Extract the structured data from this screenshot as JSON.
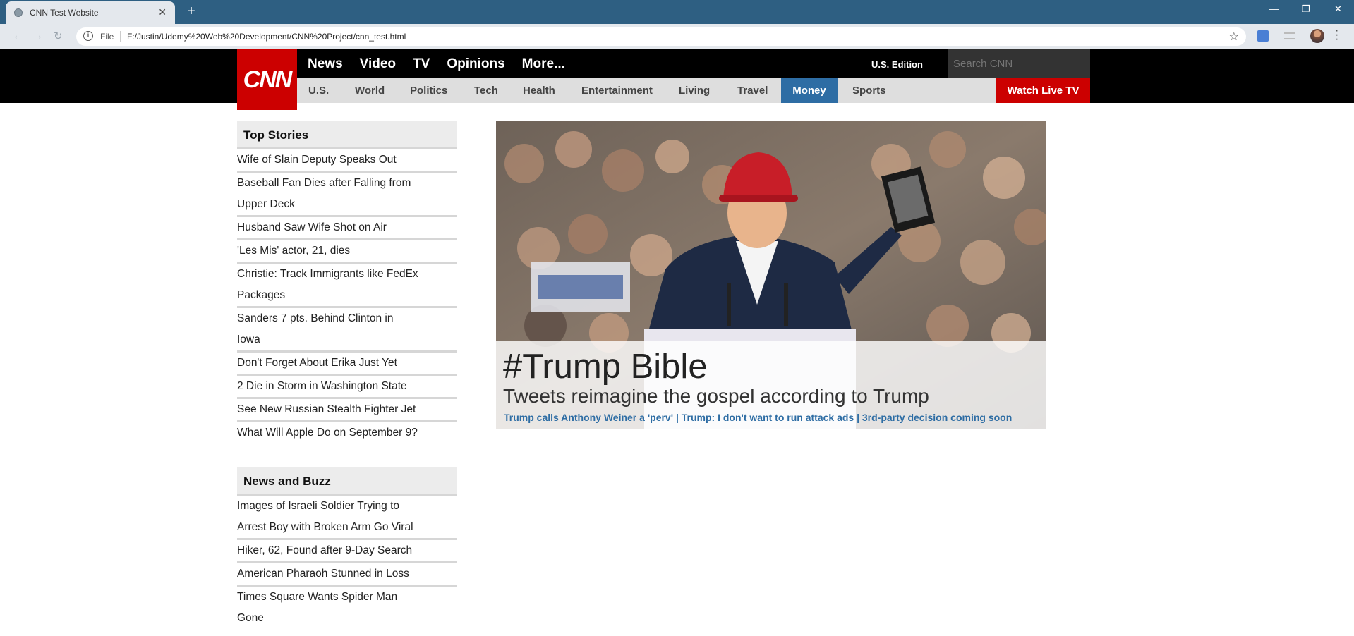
{
  "browser": {
    "tab_title": "CNN Test Website",
    "tab_close": "✕",
    "new_tab": "+",
    "scheme": "File",
    "url": "F:/Justin/Udemy%20Web%20Development/CNN%20Project/cnn_test.html",
    "window_controls": [
      "—",
      "❐",
      "✕"
    ]
  },
  "header": {
    "logo": "CNN",
    "top_nav": [
      "News",
      "Video",
      "TV",
      "Opinions",
      "More..."
    ],
    "edition": "U.S. Edition",
    "search_placeholder": "Search CNN",
    "sub_nav": [
      "U.S.",
      "World",
      "Politics",
      "Tech",
      "Health",
      "Entertainment",
      "Living",
      "Travel",
      "Money",
      "Sports"
    ],
    "active_sub_nav": "Money",
    "watch_live": "Watch Live TV",
    "colors": {
      "brand_red": "#cc0000",
      "active_blue": "#2e6da4"
    }
  },
  "sidebar": {
    "top_stories_title": "Top Stories",
    "top_stories": [
      "Wife of Slain Deputy Speaks Out",
      "Baseball Fan Dies after Falling from Upper Deck",
      "Husband Saw Wife Shot on Air",
      "'Les Mis' actor, 21, dies",
      "Christie: Track Immigrants like FedEx Packages",
      "Sanders 7 pts. Behind Clinton in Iowa",
      "Don't Forget About Erika Just Yet",
      "2 Die in Storm in Washington State",
      "See New Russian Stealth Fighter Jet",
      "What Will Apple Do on September 9?"
    ],
    "news_buzz_title": "News and Buzz",
    "news_buzz": [
      "Images of Israeli Soldier Trying to Arrest Boy with Broken Arm Go Viral",
      "Hiker, 62, Found after 9-Day Search",
      "American Pharaoh Stunned in Loss",
      "Times Square Wants Spider Man Gone"
    ]
  },
  "hero": {
    "headline": "#Trump Bible",
    "subheadline": "Tweets reimagine the gospel according to Trump",
    "related_links": "Trump calls Anthony Weiner a 'perv' | Trump: I don't want to run attack ads | 3rd-party decision coming soon"
  }
}
